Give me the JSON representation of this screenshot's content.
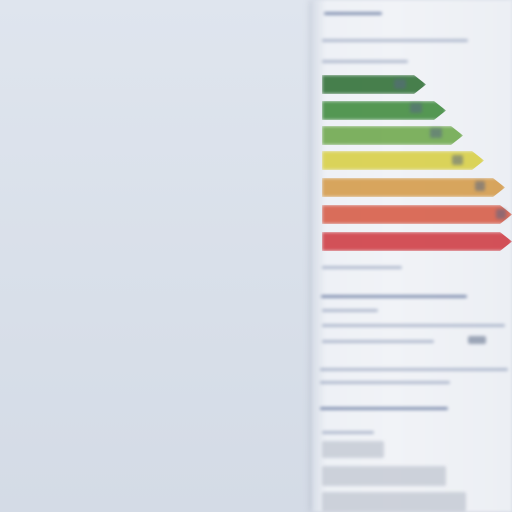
{
  "scene": {
    "subject": "energy-label",
    "colors": {
      "background": "#d9dfe8",
      "paper": "#f1f3f7",
      "text_ink": "#5c6f98",
      "bar_a": "#2f6f35",
      "bar_b": "#3f8a3d",
      "bar_c": "#6ea84c",
      "bar_d": "#d8cf44",
      "bar_e": "#d49a48",
      "bar_f": "#d65a45",
      "bar_g": "#cf3b42"
    }
  },
  "label_bars": [
    {
      "class_name": "energy-bar-a",
      "color": "#2f6f35"
    },
    {
      "class_name": "energy-bar-b",
      "color": "#3f8a3d"
    },
    {
      "class_name": "energy-bar-c",
      "color": "#6ea84c"
    },
    {
      "class_name": "energy-bar-d",
      "color": "#d8cf44"
    },
    {
      "class_name": "energy-bar-e",
      "color": "#d49a48"
    },
    {
      "class_name": "energy-bar-f",
      "color": "#d65a45"
    },
    {
      "class_name": "energy-bar-g",
      "color": "#cf3b42"
    }
  ]
}
